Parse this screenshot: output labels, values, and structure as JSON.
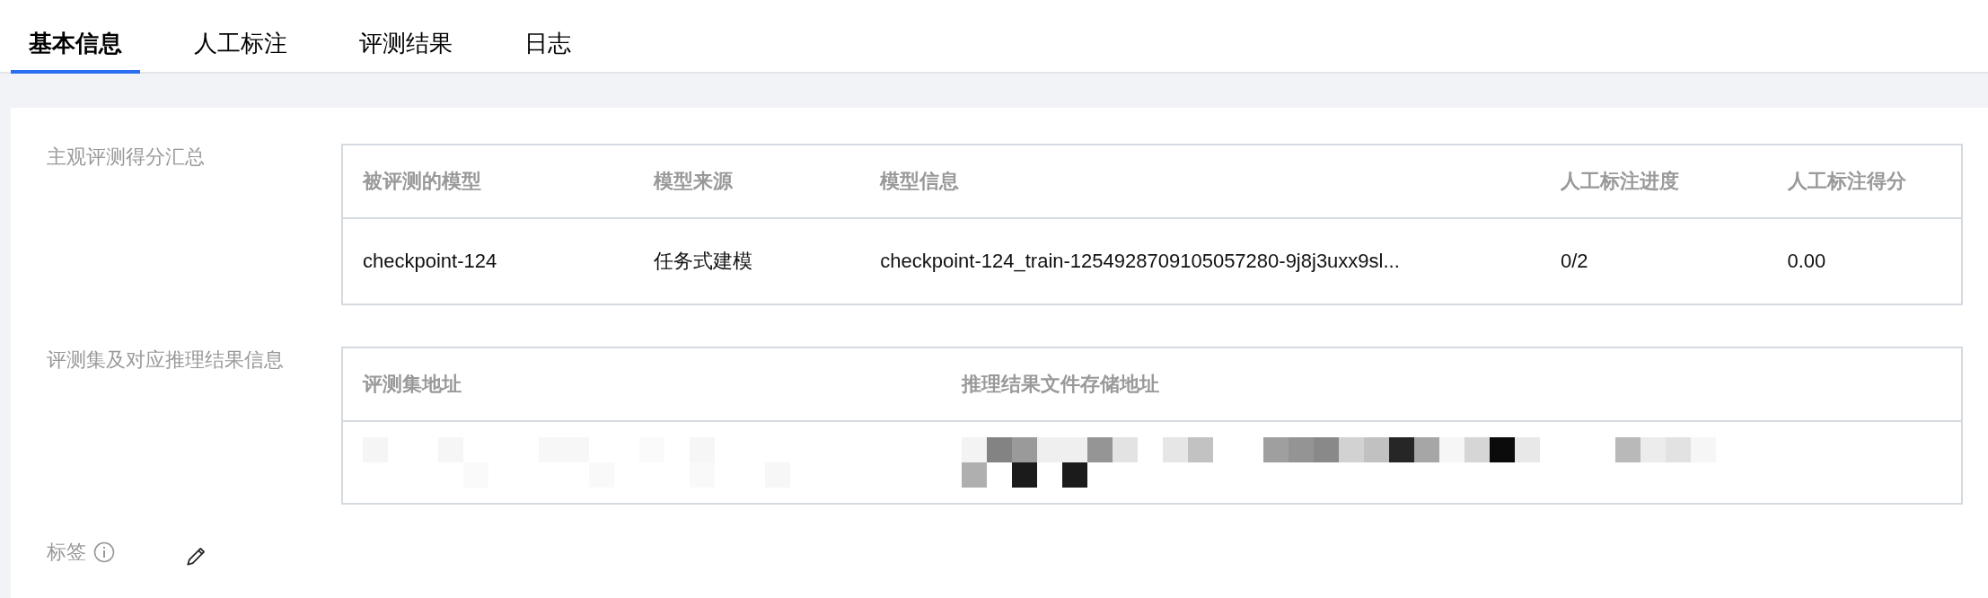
{
  "tabs": [
    {
      "label": "基本信息",
      "selected": true
    },
    {
      "label": "人工标注",
      "selected": false
    },
    {
      "label": "评测结果",
      "selected": false
    },
    {
      "label": "日志",
      "selected": false
    }
  ],
  "sections": [
    {
      "label": "主观评测得分汇总",
      "table": {
        "columns": [
          "被评测的模型",
          "模型来源",
          "模型信息",
          "人工标注进度",
          "人工标注得分"
        ],
        "rows": [
          [
            "checkpoint-124",
            "任务式建模",
            "checkpoint-124_train-1254928709105057280-9j8j3uxx9sl...",
            "0/2",
            "0.00"
          ]
        ]
      }
    },
    {
      "label": "评测集及对应推理结果信息",
      "table": {
        "columns": [
          "评测集地址",
          "推理结果文件存储地址"
        ],
        "rows": [
          [
            {
              "kind": "redacted"
            },
            {
              "kind": "redacted"
            }
          ]
        ]
      }
    }
  ],
  "tag_field": {
    "label": "标签"
  }
}
